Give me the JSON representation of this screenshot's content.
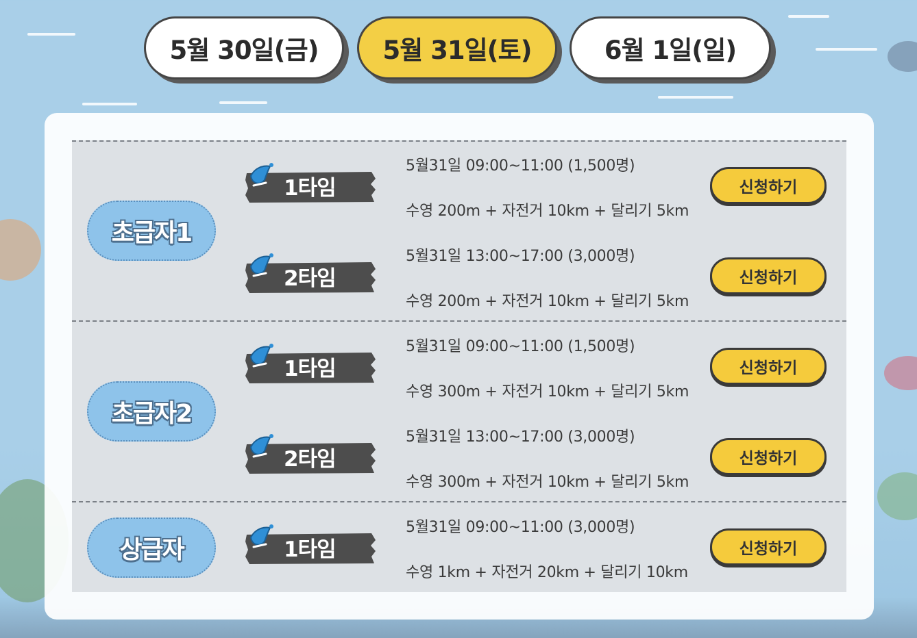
{
  "date_tabs": [
    {
      "label": "5월 30일(금)",
      "active": false
    },
    {
      "label": "5월 31일(토)",
      "active": true
    },
    {
      "label": "6월  1일(일)",
      "active": false
    }
  ],
  "colors": {
    "accent": "#f3cf45",
    "level_badge": "#8ec3ea",
    "time_badge": "#4d4d4d",
    "panel_bg": "#dde1e5"
  },
  "icons": {
    "time_badge_icon": "water-drop-icon"
  },
  "groups": [
    {
      "level": "초급자1",
      "sessions": [
        {
          "time_label": "1타임",
          "schedule": "5월31일 09:00~11:00 (1,500명)",
          "course": "수영 200m + 자전거 10km + 달리기 5km",
          "button": "신청하기"
        },
        {
          "time_label": "2타임",
          "schedule": "5월31일 13:00~17:00 (3,000명)",
          "course": "수영 200m + 자전거 10km + 달리기 5km",
          "button": "신청하기"
        }
      ]
    },
    {
      "level": "초급자2",
      "sessions": [
        {
          "time_label": "1타임",
          "schedule": "5월31일 09:00~11:00 (1,500명)",
          "course": "수영 300m + 자전거 10km + 달리기 5km",
          "button": "신청하기"
        },
        {
          "time_label": "2타임",
          "schedule": "5월31일 13:00~17:00 (3,000명)",
          "course": "수영 300m + 자전거 10km + 달리기 5km",
          "button": "신청하기"
        }
      ]
    },
    {
      "level": "상급자",
      "sessions": [
        {
          "time_label": "1타임",
          "schedule": "5월31일 09:00~11:00 (3,000명)",
          "course": "수영 1km + 자전거 20km + 달리기 10km",
          "button": "신청하기"
        }
      ]
    }
  ]
}
